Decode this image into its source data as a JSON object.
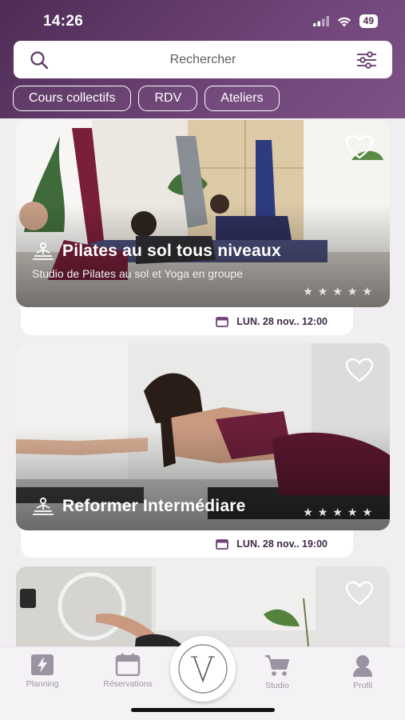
{
  "status_bar": {
    "time": "14:26",
    "battery": "49"
  },
  "search": {
    "placeholder": "Rechercher"
  },
  "filters": [
    "Cours collectifs",
    "RDV",
    "Ateliers"
  ],
  "classes": [
    {
      "title": "Pilates au sol tous niveaux",
      "subtitle": "Studio de Pilates au sol et Yoga en groupe",
      "stars": 5,
      "date": "LUN. 28 nov.. 12:00"
    },
    {
      "title": "Reformer Intermédiare",
      "subtitle": "",
      "stars": 5,
      "date": "LUN. 28 nov.. 19:00"
    }
  ],
  "tabbar": {
    "planning": "Planning",
    "reservations": "Réservations",
    "studio": "Studio",
    "profil": "Profil"
  },
  "colors": {
    "header": "#5d3766",
    "accent": "#4e2c55",
    "tab_icon": "#9a93a2"
  }
}
